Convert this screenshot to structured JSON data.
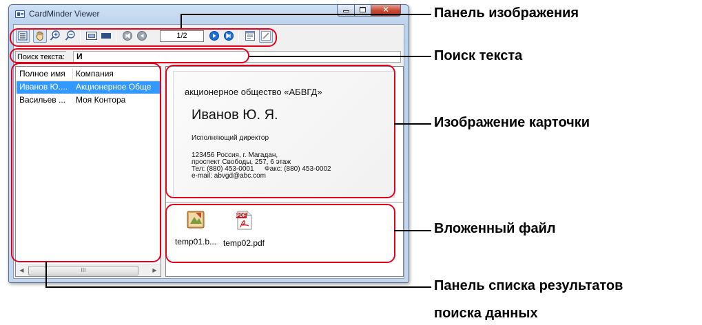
{
  "window": {
    "title": "CardMinder Viewer"
  },
  "toolbar": {
    "page_indicator": "1/2",
    "icons": [
      "list-view-icon",
      "hand-icon",
      "zoom-in-icon",
      "zoom-out-icon",
      "fit-window-icon",
      "fit-width-icon",
      "first-page-icon",
      "prev-page-icon",
      "next-page-icon",
      "last-page-icon",
      "card-properties-icon",
      "edit-icon"
    ]
  },
  "search": {
    "label": "Поиск текста:",
    "value": "И"
  },
  "list": {
    "headers": [
      "Полное имя",
      "Компания"
    ],
    "rows": [
      {
        "name": "Иванов Ю....",
        "company": "Акционерное Обще",
        "selected": true
      },
      {
        "name": "Васильев ...",
        "company": "Моя Контора",
        "selected": false
      }
    ],
    "scroll_thumb_glyph": "III"
  },
  "card": {
    "company": "акционерное общество «АБВГД»",
    "name": "Иванов Ю. Я.",
    "position": "Исполняющий директор",
    "address1": "123456 Россия, г. Магадан,",
    "address2": "проспект Свободы, 257, 6 этаж",
    "phone": "Тел: (880) 453-0001",
    "fax": "Факс: (880) 453-0002",
    "email": "e-mail: abvgd@abc.com"
  },
  "attachments": [
    {
      "label": "temp01.b...",
      "icon": "bitmap-file-icon"
    },
    {
      "label": "temp02.pdf",
      "icon": "pdf-file-icon",
      "badge": "PDF"
    }
  ],
  "annotations": {
    "image_panel": "Панель изображения",
    "search_text": "Поиск текста",
    "card_image": "Изображение карточки",
    "attached_file": "Вложенный файл",
    "results_panel_line1": "Панель списка результатов",
    "results_panel_line2": "поиска данных"
  },
  "colors": {
    "annotation_red": "#e3001b",
    "selection_blue": "#3399ff",
    "close_button": "#c6442a"
  }
}
